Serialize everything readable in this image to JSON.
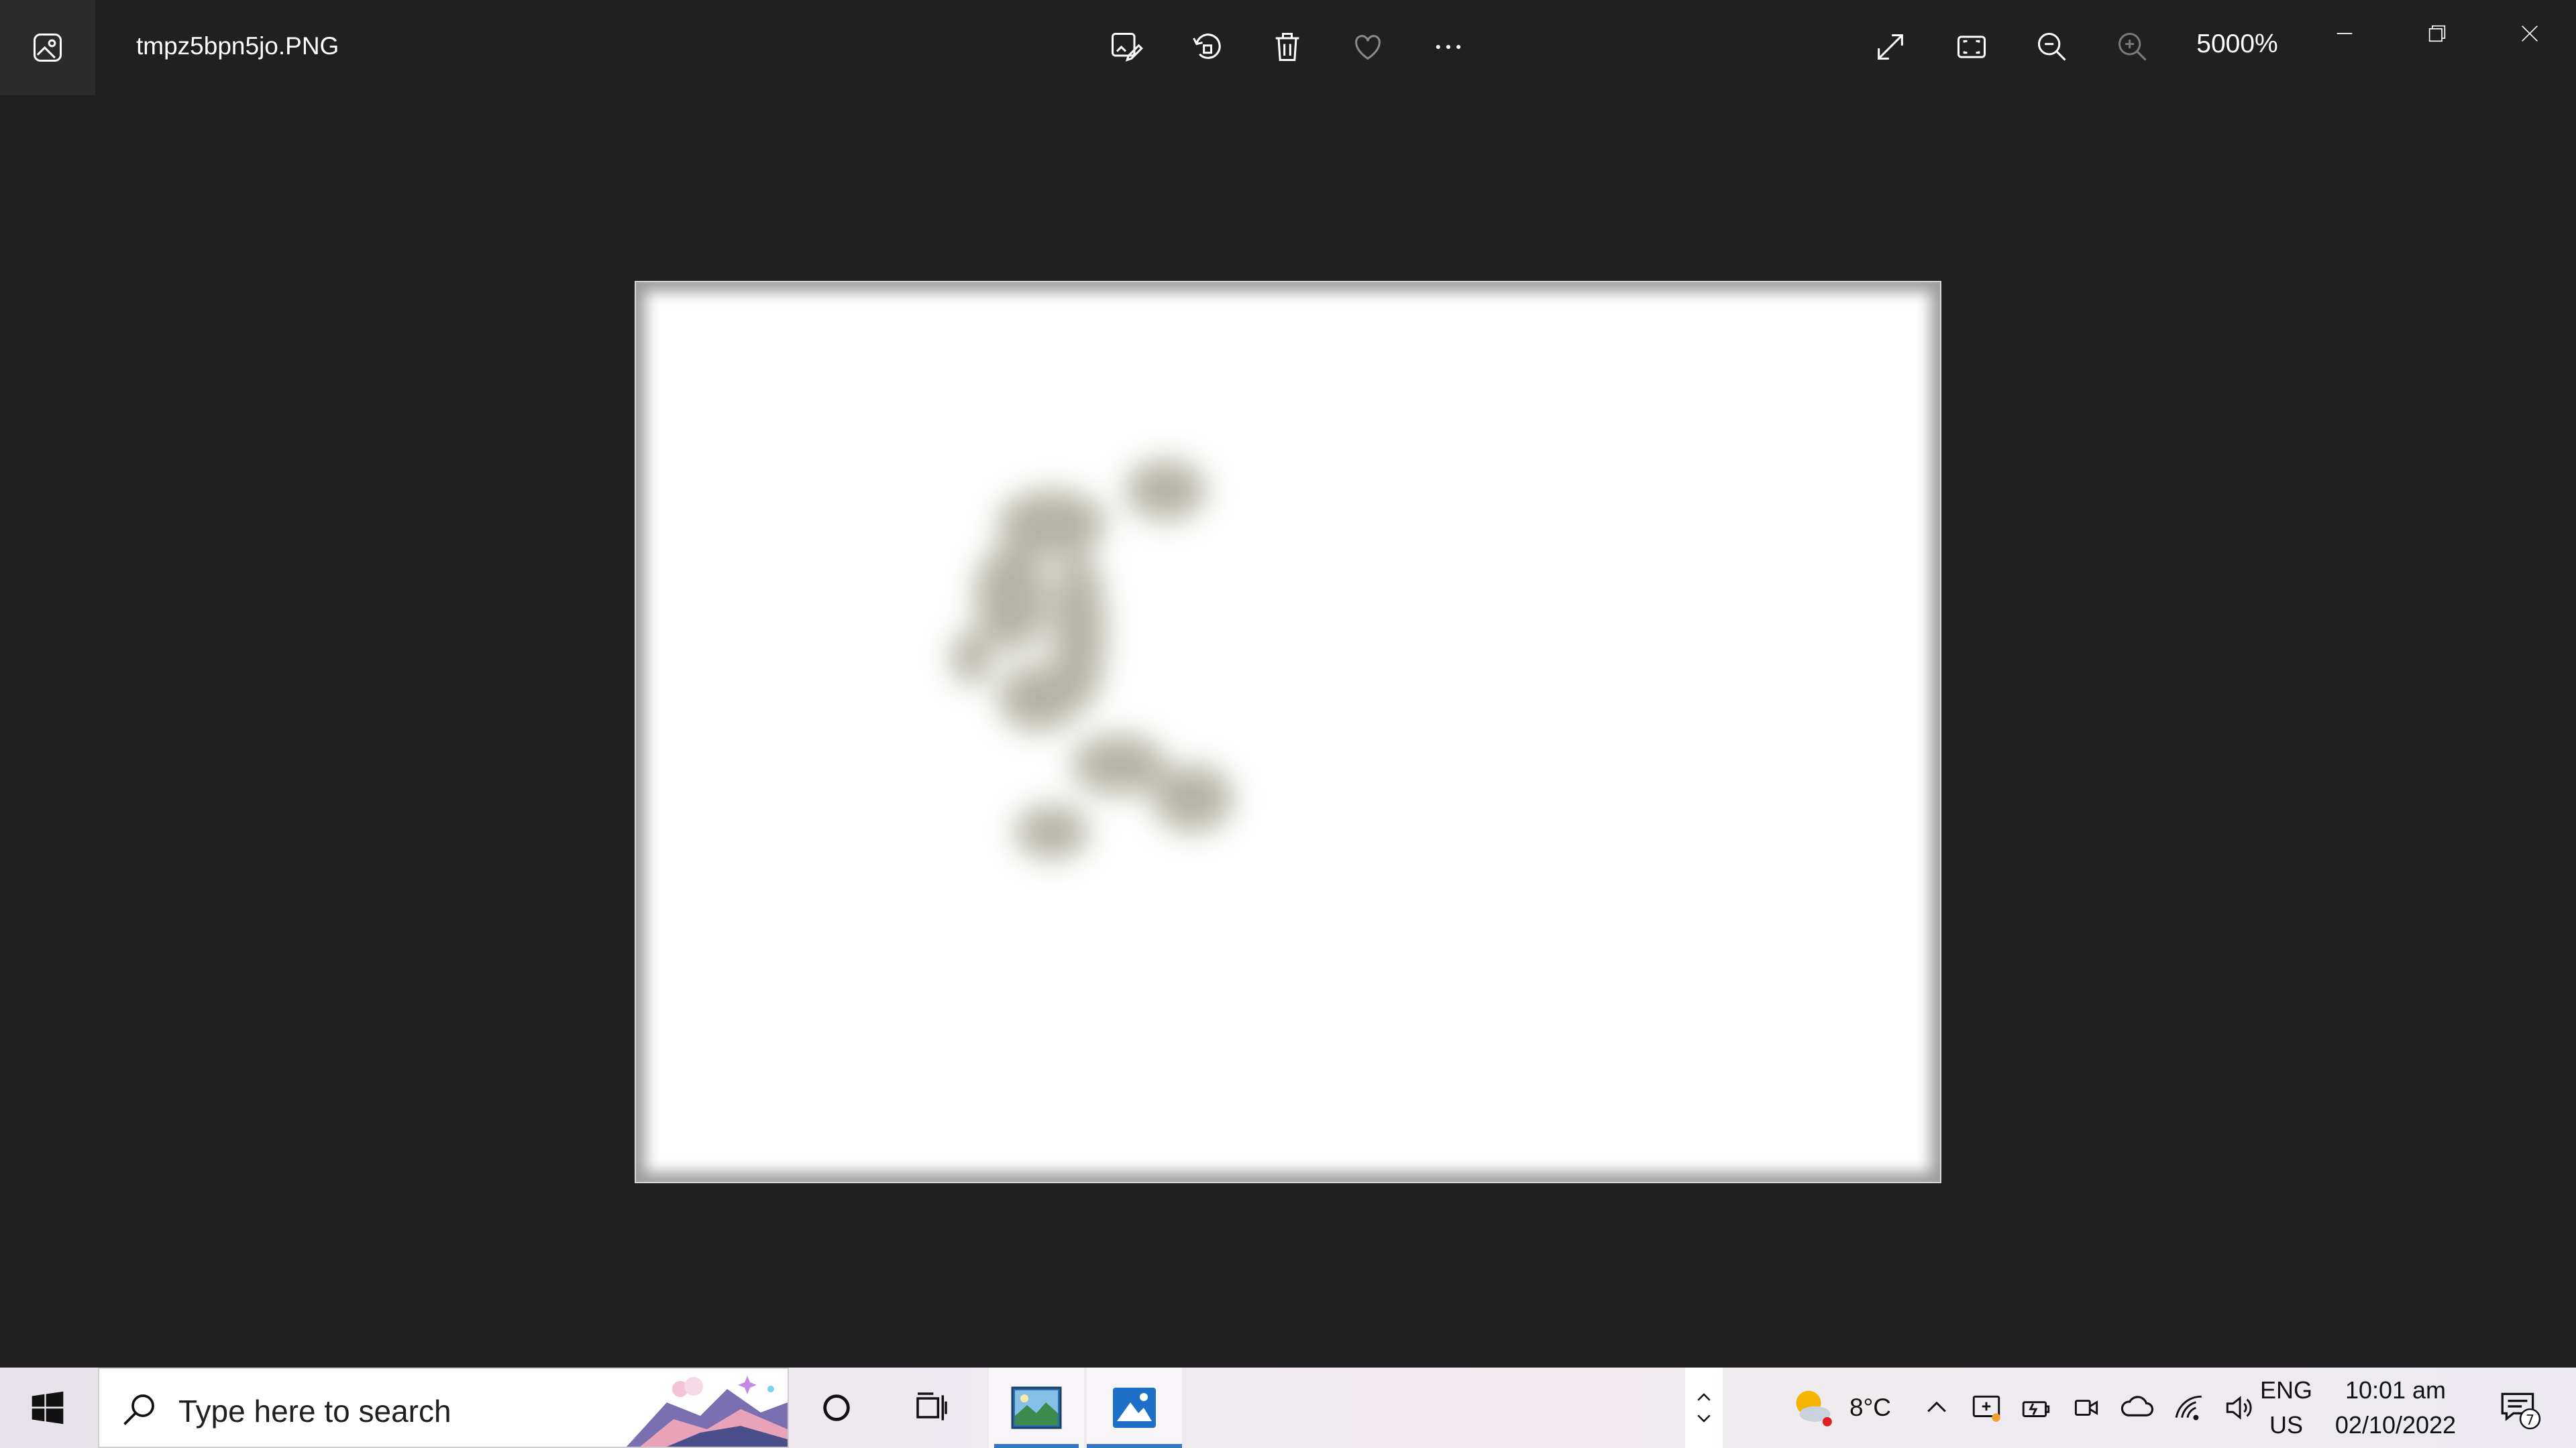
{
  "window": {
    "file_name": "tmpz5bpn5jo.PNG",
    "zoom_level": "5000%"
  },
  "toolbar": {
    "icons": [
      "edit-image-icon",
      "rotate-icon",
      "delete-icon",
      "favorite-icon",
      "more-icon"
    ],
    "right_icons": [
      "fullscreen-icon",
      "fit-to-window-icon",
      "zoom-out-icon",
      "zoom-in-icon"
    ]
  },
  "window_controls": [
    "minimize-icon",
    "restore-icon",
    "close-icon"
  ],
  "taskbar": {
    "search_placeholder": "Type here to search",
    "weather_temp": "8°C",
    "language_line1": "ENG",
    "language_line2": "US",
    "time": "10:01 am",
    "date": "02/10/2022",
    "notification_count": "7"
  },
  "colors": {
    "window_bg": "#202020",
    "taskbar_accent": "#3478c5",
    "photo_bg": "#ffffff"
  }
}
